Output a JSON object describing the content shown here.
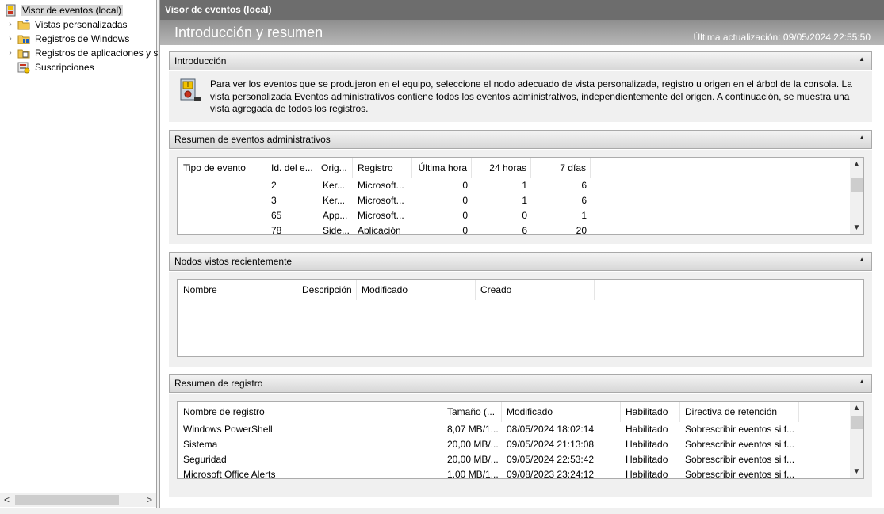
{
  "tree": {
    "items": [
      {
        "label": "Visor de eventos (local)",
        "icon": "event-viewer-icon",
        "expandable": false,
        "selected": true
      },
      {
        "label": "Vistas personalizadas",
        "icon": "folder-filter-icon",
        "expandable": true
      },
      {
        "label": "Registros de Windows",
        "icon": "windows-logs-icon",
        "expandable": true
      },
      {
        "label": "Registros de aplicaciones y s",
        "icon": "app-logs-icon",
        "expandable": true
      },
      {
        "label": "Suscripciones",
        "icon": "subscriptions-icon",
        "expandable": false
      }
    ]
  },
  "main": {
    "window_title": "Visor de eventos (local)",
    "header_title": "Introducción y resumen",
    "last_update": "Última actualización: 09/05/2024 22:55:50"
  },
  "sections": {
    "intro": {
      "title": "Introducción",
      "text": "Para ver los eventos que se produjeron en el equipo, seleccione el nodo adecuado de vista personalizada, registro u origen en el árbol de la consola. La vista personalizada Eventos administrativos contiene todos los eventos administrativos, independientemente del origen. A continuación, se muestra una vista agregada de todos los registros."
    },
    "admin": {
      "title": "Resumen de eventos administrativos",
      "columns": [
        "Tipo de evento",
        "Id. del e...",
        "Orig...",
        "Registro",
        "Última hora",
        "24 horas",
        "7 días"
      ],
      "rows": [
        {
          "type": "",
          "id": "2",
          "origin": "Ker...",
          "log": "Microsoft...",
          "hour": "0",
          "day": "1",
          "week": "6"
        },
        {
          "type": "",
          "id": "3",
          "origin": "Ker...",
          "log": "Microsoft...",
          "hour": "0",
          "day": "1",
          "week": "6"
        },
        {
          "type": "",
          "id": "65",
          "origin": "App...",
          "log": "Microsoft...",
          "hour": "0",
          "day": "0",
          "week": "1"
        },
        {
          "type": "",
          "id": "78",
          "origin": "Side...",
          "log": "Aplicación",
          "hour": "0",
          "day": "6",
          "week": "20"
        }
      ]
    },
    "recent": {
      "title": "Nodos vistos recientemente",
      "columns": [
        "Nombre",
        "Descripción",
        "Modificado",
        "Creado"
      ]
    },
    "logs": {
      "title": "Resumen de registro",
      "columns": [
        "Nombre de registro",
        "Tamaño (...",
        "Modificado",
        "Habilitado",
        "Directiva de retención"
      ],
      "rows": [
        {
          "name": "Windows PowerShell",
          "size": "8,07 MB/1...",
          "modified": "08/05/2024 18:02:14",
          "enabled": "Habilitado",
          "retention": "Sobrescribir eventos si f..."
        },
        {
          "name": "Sistema",
          "size": "20,00 MB/...",
          "modified": "09/05/2024 21:13:08",
          "enabled": "Habilitado",
          "retention": "Sobrescribir eventos si f..."
        },
        {
          "name": "Seguridad",
          "size": "20,00 MB/...",
          "modified": "09/05/2024 22:53:42",
          "enabled": "Habilitado",
          "retention": "Sobrescribir eventos si f..."
        },
        {
          "name": "Microsoft Office Alerts",
          "size": "1,00 MB/1...",
          "modified": "09/08/2023 23:24:12",
          "enabled": "Habilitado",
          "retention": "Sobrescribir eventos si f..."
        }
      ]
    }
  },
  "icons": {
    "chevron_right": "›",
    "collapse": "▲",
    "scroll_up": "▲",
    "scroll_down": "▼",
    "scroll_left": "<",
    "scroll_right": ">"
  }
}
